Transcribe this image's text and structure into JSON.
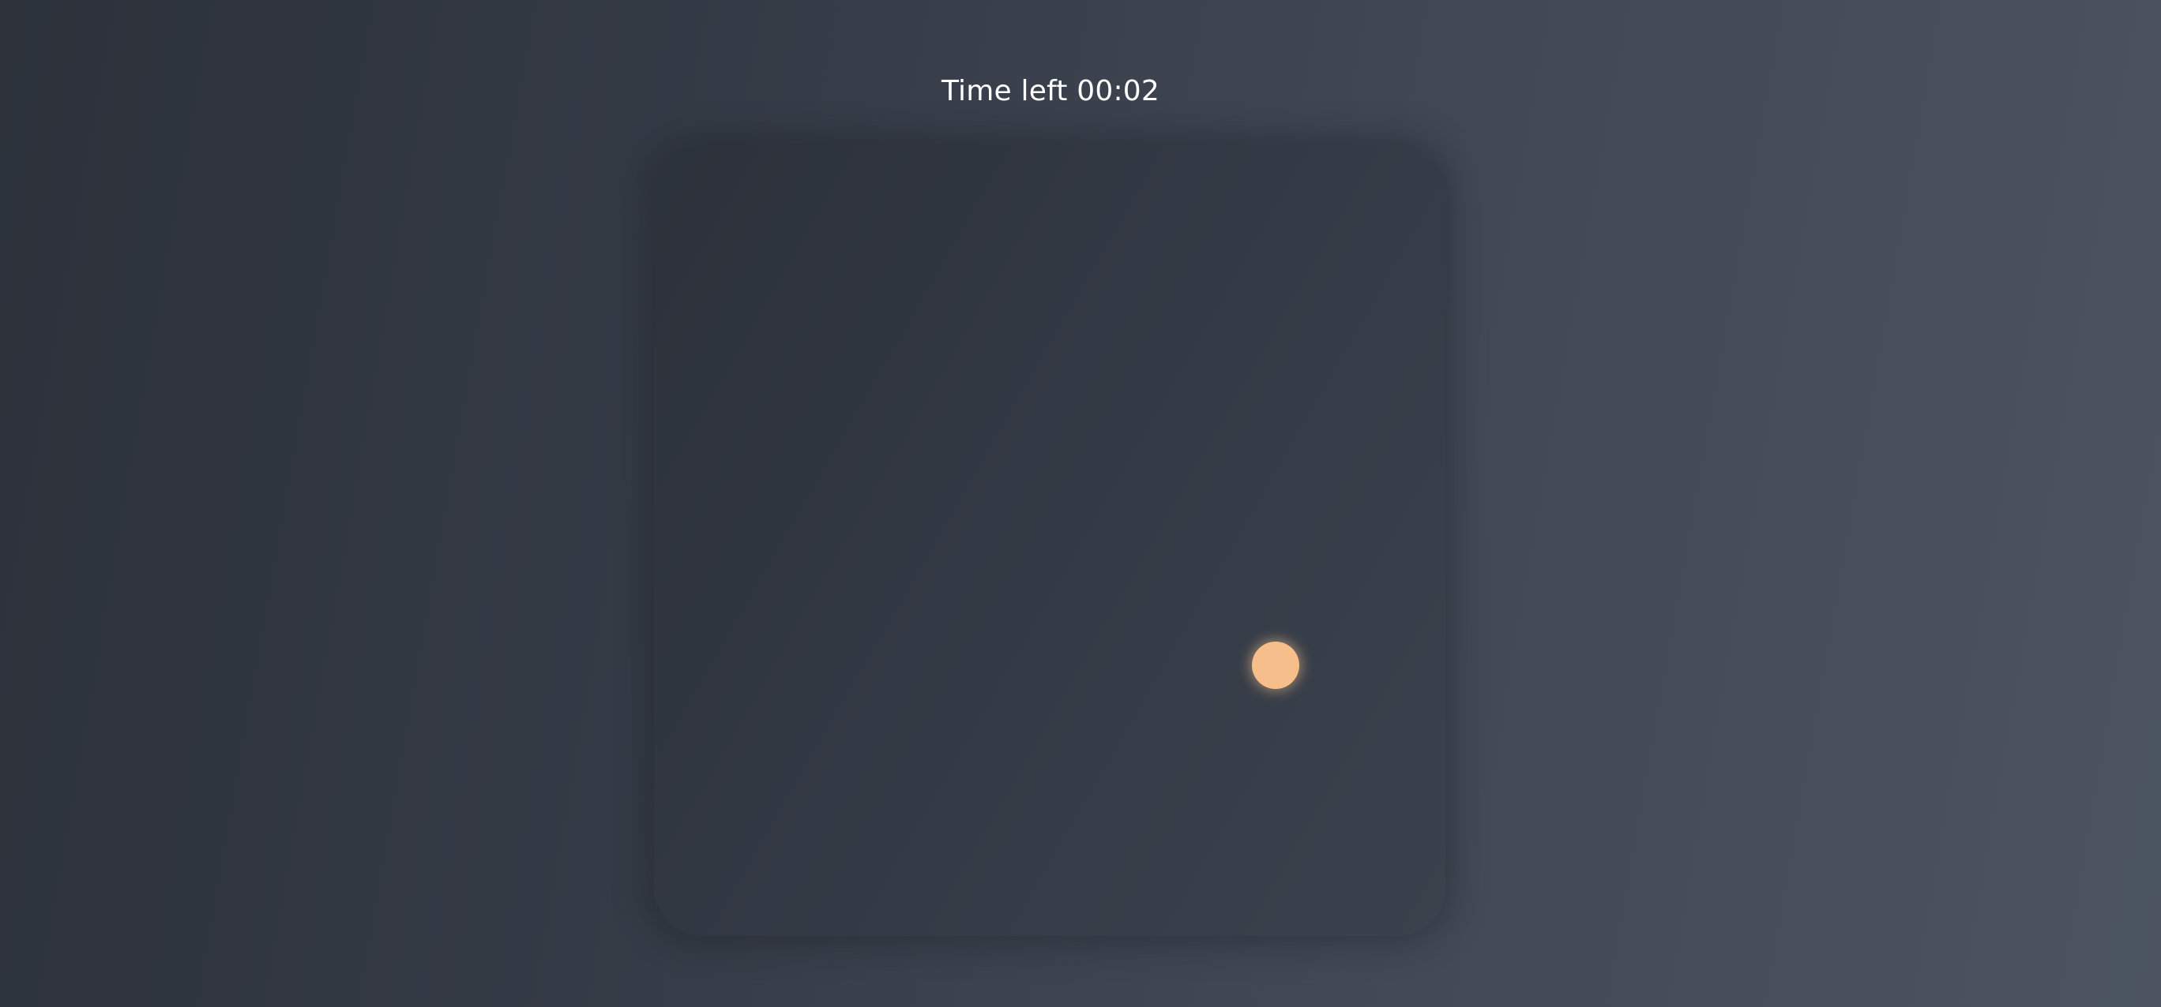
{
  "timer": {
    "label": "Time left 00:02"
  },
  "colors": {
    "background_start": "#2c313a",
    "background_end": "#4b5460",
    "board": "#343a45",
    "target": "#f5be8a",
    "text": "#ffffff"
  },
  "target": {
    "icon": "circle-dot-icon"
  }
}
